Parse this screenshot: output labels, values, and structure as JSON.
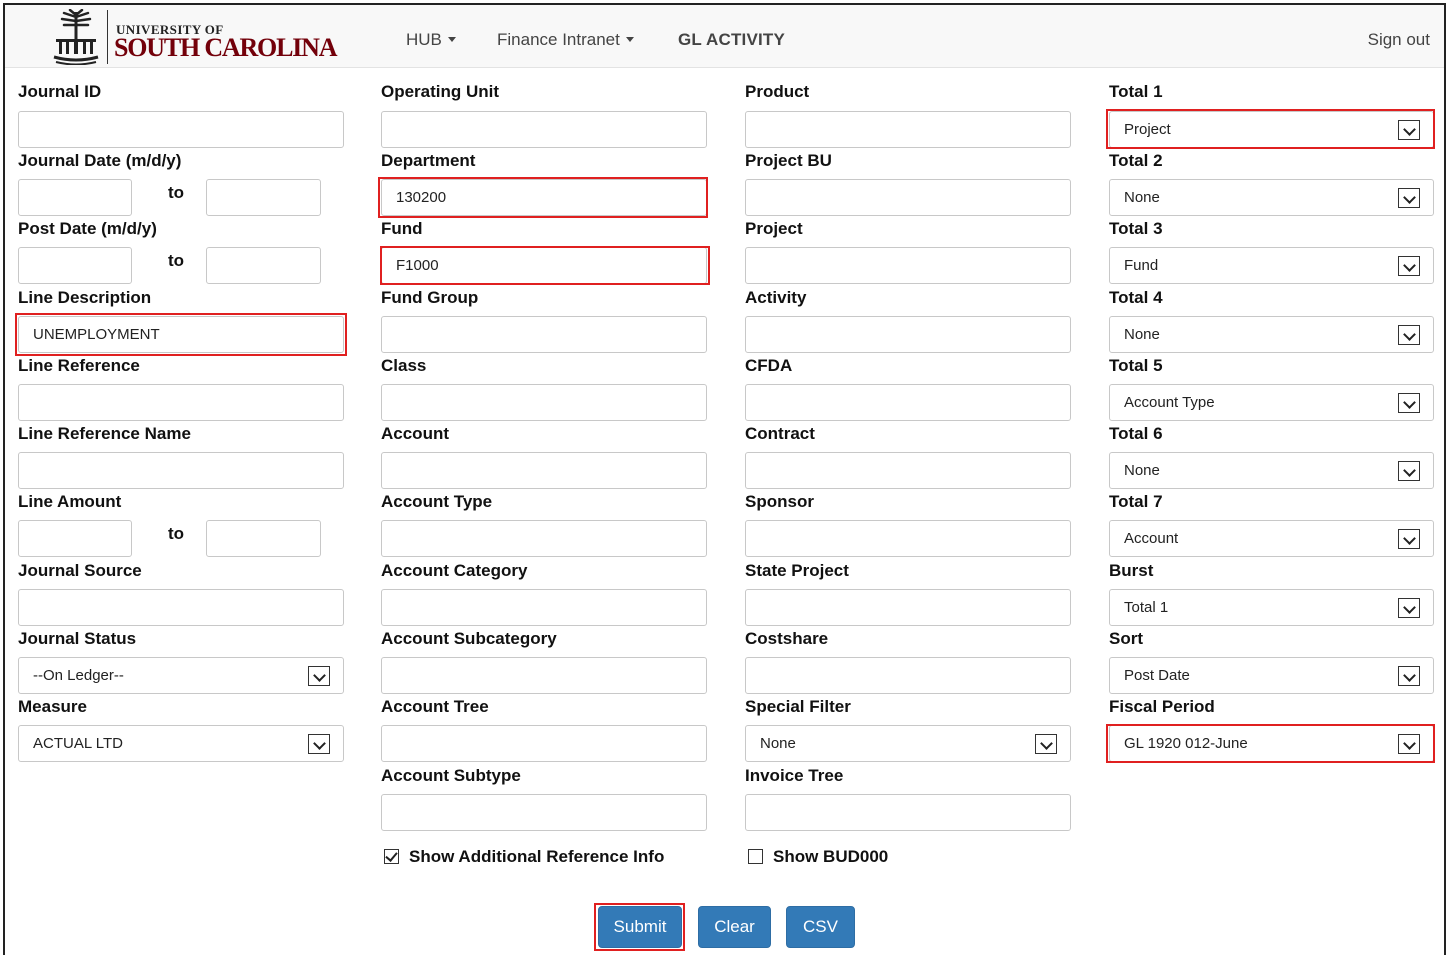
{
  "header": {
    "logo_line1": "UNIVERSITY OF",
    "logo_line2": "SOUTH CAROLINA",
    "nav_hub": "HUB",
    "nav_finance": "Finance Intranet",
    "nav_gl": "GL ACTIVITY",
    "sign_out": "Sign out"
  },
  "to_label": "to",
  "col1": {
    "journal_id": "Journal ID",
    "journal_date": "Journal Date (m/d/y)",
    "post_date": "Post Date (m/d/y)",
    "line_description": "Line Description",
    "line_description_value": "UNEMPLOYMENT",
    "line_reference": "Line Reference",
    "line_reference_name": "Line Reference Name",
    "line_amount": "Line Amount",
    "journal_source": "Journal Source",
    "journal_status": "Journal Status",
    "journal_status_value": "--On Ledger--",
    "measure": "Measure",
    "measure_value": "ACTUAL LTD"
  },
  "col2": {
    "operating_unit": "Operating Unit",
    "department": "Department",
    "department_value": "130200",
    "fund": "Fund",
    "fund_value": "F1000",
    "fund_group": "Fund Group",
    "class": "Class",
    "account": "Account",
    "account_type": "Account Type",
    "account_category": "Account Category",
    "account_subcategory": "Account Subcategory",
    "account_tree": "Account Tree",
    "account_subtype": "Account Subtype",
    "show_additional": "Show Additional Reference Info"
  },
  "col3": {
    "product": "Product",
    "project_bu": "Project BU",
    "project": "Project",
    "activity": "Activity",
    "cfda": "CFDA",
    "contract": "Contract",
    "sponsor": "Sponsor",
    "state_project": "State Project",
    "costshare": "Costshare",
    "special_filter": "Special Filter",
    "special_filter_value": "None",
    "invoice_tree": "Invoice Tree",
    "show_bud000": "Show BUD000"
  },
  "col4": {
    "total1": "Total 1",
    "total1_value": "Project",
    "total2": "Total 2",
    "total2_value": "None",
    "total3": "Total 3",
    "total3_value": "Fund",
    "total4": "Total 4",
    "total4_value": "None",
    "total5": "Total 5",
    "total5_value": "Account Type",
    "total6": "Total 6",
    "total6_value": "None",
    "total7": "Total 7",
    "total7_value": "Account",
    "burst": "Burst",
    "burst_value": "Total 1",
    "sort": "Sort",
    "sort_value": "Post Date",
    "fiscal_period": "Fiscal Period",
    "fiscal_period_value": "GL 1920 012-June"
  },
  "buttons": {
    "submit": "Submit",
    "clear": "Clear",
    "csv": "CSV"
  },
  "colors": {
    "primary": "#337ab7",
    "highlight": "#e02020",
    "brand": "#73000a"
  }
}
